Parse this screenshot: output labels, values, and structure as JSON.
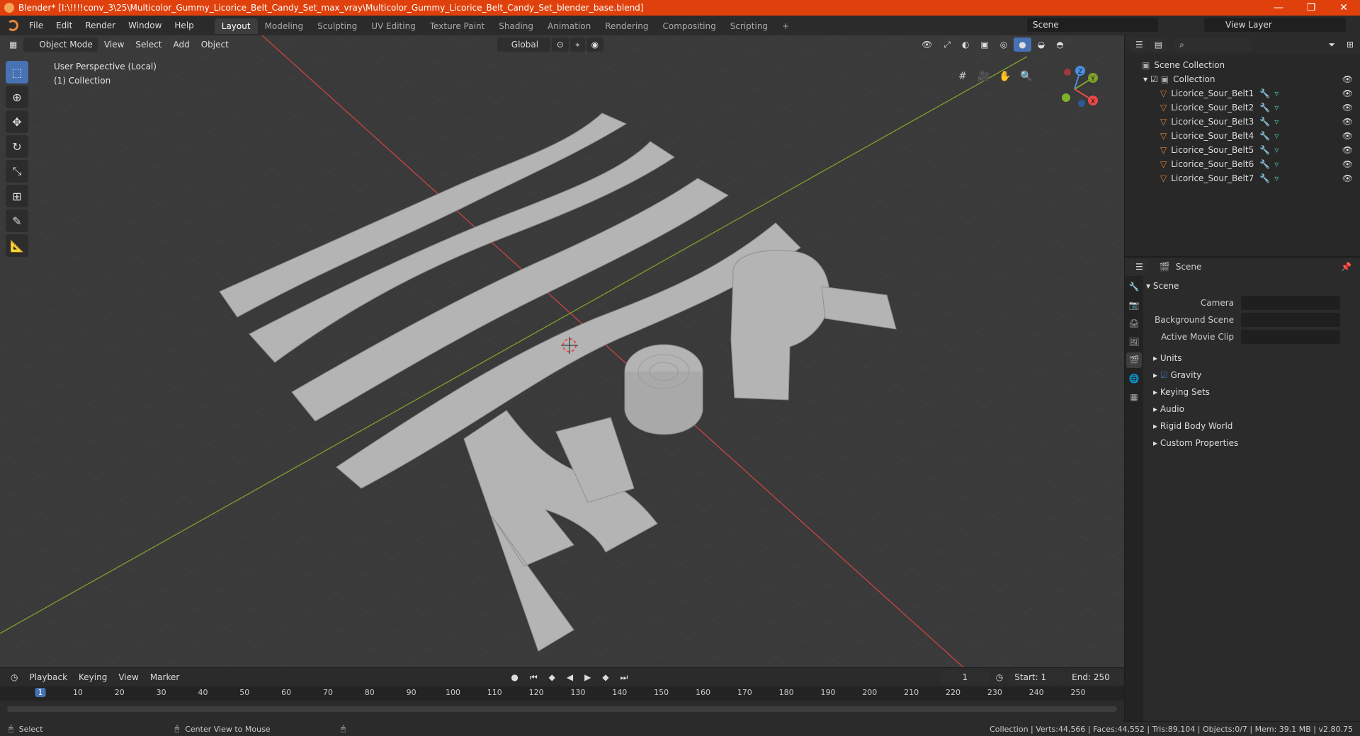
{
  "window": {
    "title": "Blender* [I:\\!!!!conv_3\\25\\Multicolor_Gummy_Licorice_Belt_Candy_Set_max_vray\\Multicolor_Gummy_Licorice_Belt_Candy_Set_blender_base.blend]",
    "minimize": "—",
    "maximize": "❐",
    "close": "✕"
  },
  "menu": [
    "File",
    "Edit",
    "Render",
    "Window",
    "Help"
  ],
  "workspaces": [
    "Layout",
    "Modeling",
    "Sculpting",
    "UV Editing",
    "Texture Paint",
    "Shading",
    "Animation",
    "Rendering",
    "Compositing",
    "Scripting"
  ],
  "scene_name": "Scene",
  "view_layer": "View Layer",
  "viewport": {
    "mode": "Object Mode",
    "menus": [
      "View",
      "Select",
      "Add",
      "Object"
    ],
    "orientation": "Global",
    "perspective": "User Perspective (Local)",
    "collection": "(1) Collection"
  },
  "outliner": {
    "root": "Scene Collection",
    "collection": "Collection",
    "items": [
      "Licorice_Sour_Belt1",
      "Licorice_Sour_Belt2",
      "Licorice_Sour_Belt3",
      "Licorice_Sour_Belt4",
      "Licorice_Sour_Belt5",
      "Licorice_Sour_Belt6",
      "Licorice_Sour_Belt7"
    ]
  },
  "properties": {
    "context": "Scene",
    "panel": "Scene",
    "camera_label": "Camera",
    "bg_scene_label": "Background Scene",
    "movie_clip_label": "Active Movie Clip",
    "sections": [
      "Units",
      "Gravity",
      "Keying Sets",
      "Audio",
      "Rigid Body World",
      "Custom Properties"
    ]
  },
  "timeline": {
    "menus": [
      "Playback",
      "Keying",
      "View",
      "Marker"
    ],
    "current_frame": "1",
    "start_label": "Start:",
    "start": "1",
    "end_label": "End:",
    "end": "250",
    "ticks": [
      "1",
      "10",
      "20",
      "30",
      "40",
      "50",
      "60",
      "70",
      "80",
      "90",
      "100",
      "110",
      "120",
      "130",
      "140",
      "150",
      "160",
      "170",
      "180",
      "190",
      "200",
      "210",
      "220",
      "230",
      "240",
      "250"
    ]
  },
  "status": {
    "left": "Select",
    "middle": "Center View to Mouse",
    "right": "Collection | Verts:44,566 | Faces:44,552 | Tris:89,104 | Objects:0/7 | Mem: 39.1 MB | v2.80.75"
  },
  "colors": {
    "accent": "#4772b3",
    "title_bar": "#e0410c",
    "x_axis": "#c94444",
    "y_axis": "#7fa02c"
  }
}
